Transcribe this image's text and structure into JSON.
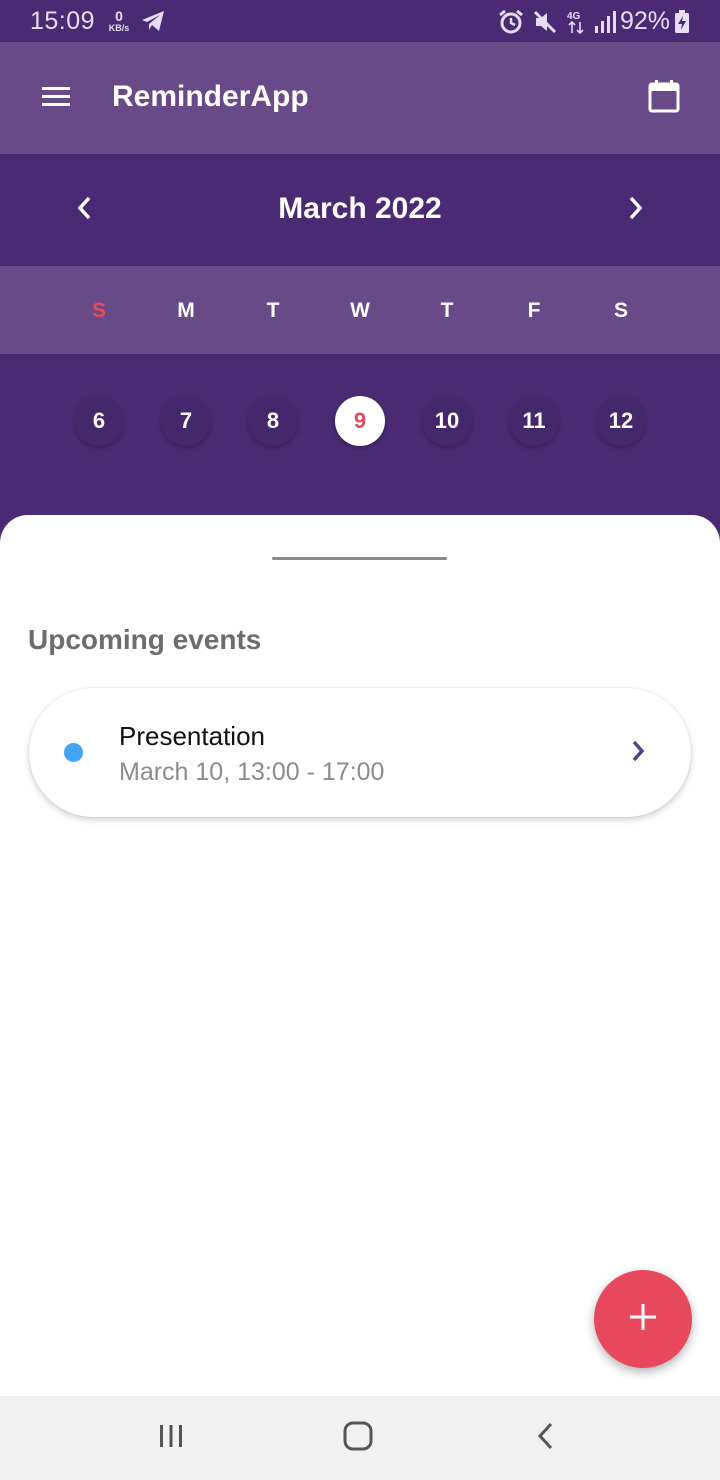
{
  "status_bar": {
    "time": "15:09",
    "net_speed_value": "0",
    "net_speed_unit": "KB/s",
    "battery_percent": "92%",
    "icons": [
      "telegram-icon",
      "alarm-icon",
      "mute-icon",
      "network-4g-icon",
      "signal-icon",
      "battery-charging-icon"
    ]
  },
  "app_bar": {
    "title": "ReminderApp",
    "left_icon": "menu-icon",
    "right_icon": "calendar-icon",
    "background": "#684a88"
  },
  "calendar": {
    "month_label": "March 2022",
    "weekdays": [
      "S",
      "M",
      "T",
      "W",
      "T",
      "F",
      "S"
    ],
    "dates": [
      "6",
      "7",
      "8",
      "9",
      "10",
      "11",
      "12"
    ],
    "selected_date": "9",
    "header_background": "#4a2a73",
    "sunday_color": "#e24a5d"
  },
  "sheet": {
    "section_title": "Upcoming events",
    "events": [
      {
        "title": "Presentation",
        "time": "March 10, 13:00 - 17:00",
        "dot_color": "#42a5f5"
      }
    ]
  },
  "fab": {
    "icon": "plus-icon",
    "color": "#e8485b"
  },
  "nav_bar": {
    "icons": [
      "recent-apps-icon",
      "home-icon",
      "back-icon"
    ]
  }
}
